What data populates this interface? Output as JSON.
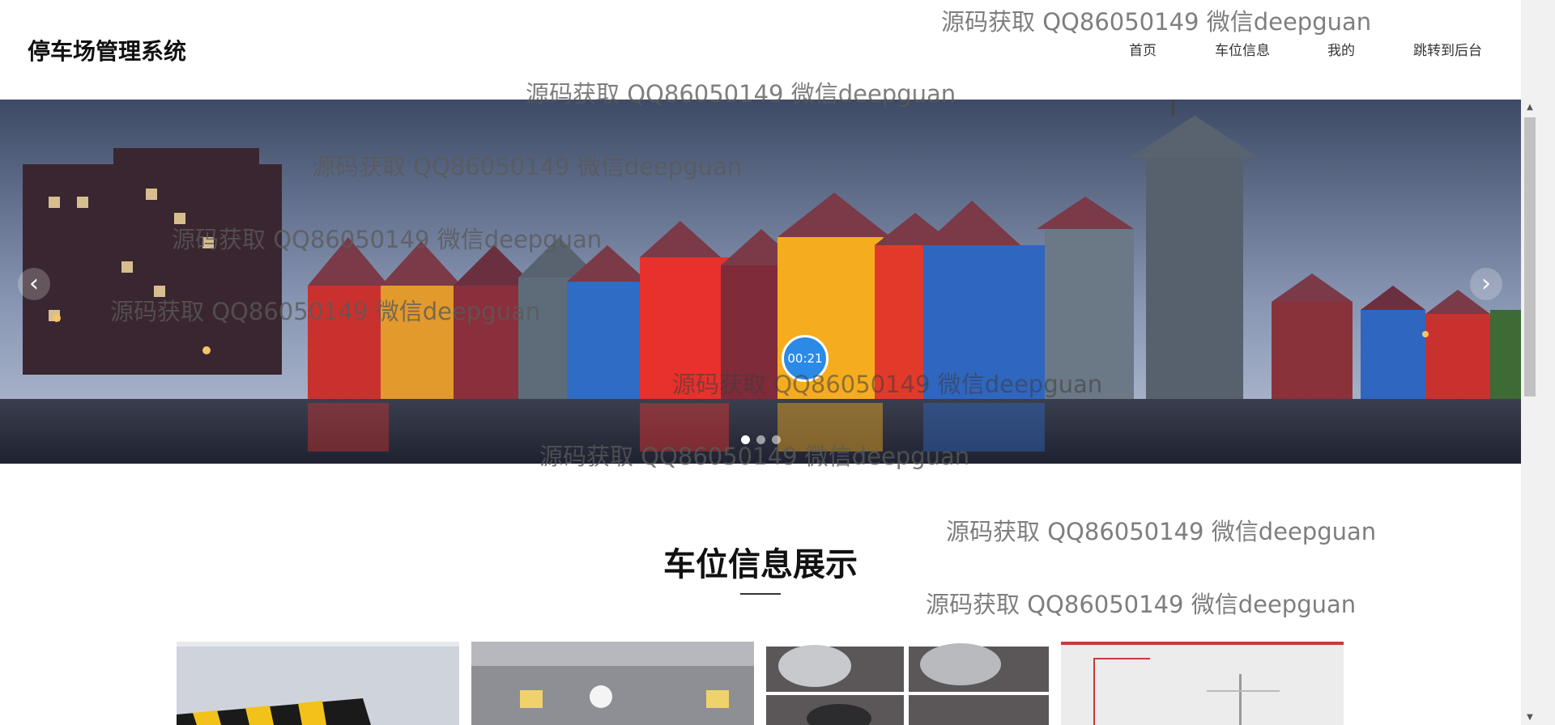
{
  "header": {
    "logo": "停车场管理系统",
    "nav": [
      "首页",
      "车位信息",
      "我的",
      "跳转到后台"
    ]
  },
  "banner": {
    "timer": "00:21",
    "prev_icon": "chevron-left-icon",
    "next_icon": "chevron-right-icon",
    "dots": 3,
    "active_dot": 0
  },
  "section": {
    "title": "车位信息展示"
  },
  "watermark": "源码获取 QQ86050149 微信deepguan",
  "watermarks": [
    "源码获取 QQ86050149 微信deepguan",
    "源码获取 QQ86050149 微信deepguan",
    "源码获取 QQ86050149 微信deepguan",
    "源码获取 QQ86050149 微信deepguan",
    "源码获取 QQ86050149 微信deepguan",
    "源码获取 QQ86050149 微信deepguan",
    "源码获取 QQ86050149 微信deepguan",
    "源码获取 QQ86050149 微信deepguan",
    "源码获取 QQ86050149 微信deepguan"
  ],
  "colors": {
    "timer_blue": "#2b8ae6"
  }
}
